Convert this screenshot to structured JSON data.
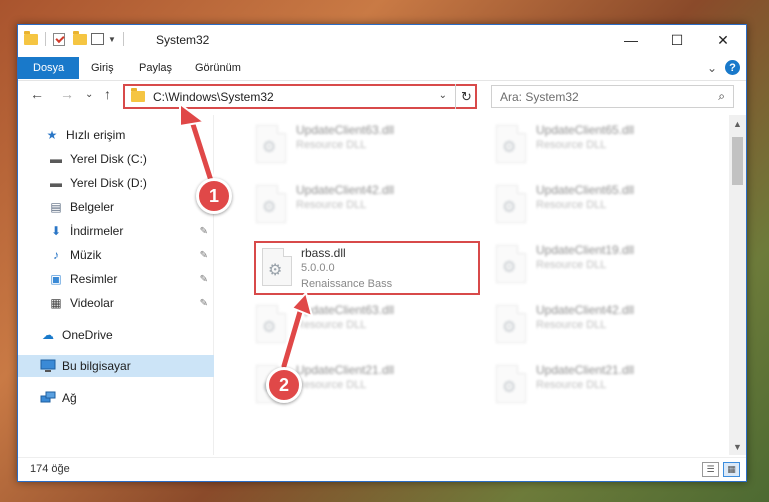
{
  "window": {
    "title": "System32",
    "controls": {
      "minimize": "—",
      "maximize": "☐",
      "close": "✕"
    }
  },
  "ribbon": {
    "tabs": [
      "Dosya",
      "Giriş",
      "Paylaş",
      "Görünüm"
    ],
    "expand_glyph": "⌄",
    "help_glyph": "?"
  },
  "nav": {
    "back": "←",
    "forward": "→",
    "recent": "⌄",
    "up": "↑"
  },
  "address": {
    "path": "C:\\Windows\\System32",
    "dropdown": "⌄",
    "refresh": "↻"
  },
  "search": {
    "placeholder": "Ara: System32",
    "icon": "⌕"
  },
  "sidebar": {
    "items": [
      {
        "label": "Hızlı erişim",
        "icon": "star-icon",
        "glyph": "★",
        "color": "#2a76c6"
      },
      {
        "label": "Yerel Disk (C:)",
        "icon": "drive-icon",
        "glyph": "▬",
        "color": "#5a5a5a"
      },
      {
        "label": "Yerel Disk (D:)",
        "icon": "drive-icon",
        "glyph": "▬",
        "color": "#5a5a5a"
      },
      {
        "label": "Belgeler",
        "icon": "document-icon",
        "glyph": "▤",
        "color": "#5a6a80",
        "pin": "📌"
      },
      {
        "label": "İndirmeler",
        "icon": "download-icon",
        "glyph": "⬇",
        "color": "#2a76c6",
        "pin": "📌"
      },
      {
        "label": "Müzik",
        "icon": "music-icon",
        "glyph": "♪",
        "color": "#2a76c6",
        "pin": "📌"
      },
      {
        "label": "Resimler",
        "icon": "pictures-icon",
        "glyph": "▣",
        "color": "#3a8ad6",
        "pin": "📌"
      },
      {
        "label": "Videolar",
        "icon": "video-icon",
        "glyph": "▦",
        "color": "#444",
        "pin": "📌"
      },
      {
        "label": "OneDrive",
        "icon": "cloud-icon",
        "glyph": "☁",
        "color": "#1979ca"
      },
      {
        "label": "Bu bilgisayar",
        "icon": "computer-icon",
        "glyph": "🖥",
        "color": "#2a76c6"
      },
      {
        "label": "Ağ",
        "icon": "network-icon",
        "glyph": "🖧",
        "color": "#2a76c6"
      }
    ]
  },
  "files": [
    {
      "name": "UpdateClient63.dll",
      "desc": "Resource DLL"
    },
    {
      "name": "UpdateClient65.dll",
      "desc": "Resource DLL"
    },
    {
      "name": "UpdateClient42.dll",
      "desc": "Resource DLL"
    },
    {
      "name": "UpdateClient65.dll",
      "desc": "Resource DLL"
    },
    {
      "name": "rbass.dll",
      "version": "5.0.0.0",
      "desc": "Renaissance Bass"
    },
    {
      "name": "UpdateClient19.dll",
      "desc": "Resource DLL"
    },
    {
      "name": "UpdateClient63.dll",
      "desc": "Resource DLL"
    },
    {
      "name": "UpdateClient42.dll",
      "desc": "Resource DLL"
    },
    {
      "name": "UpdateClient21.dll",
      "desc": "Resource DLL"
    },
    {
      "name": "UpdateClient21.dll",
      "desc": "Resource DLL"
    }
  ],
  "scrollbar": {
    "up": "▲",
    "down": "▼"
  },
  "status": {
    "count": "174 öğe",
    "details_view": "☰",
    "tiles_view": "▦"
  },
  "callouts": [
    "1",
    "2"
  ],
  "colors": {
    "accent": "#1979ca",
    "highlight": "#d84a4a",
    "selected": "#cce4f7"
  }
}
